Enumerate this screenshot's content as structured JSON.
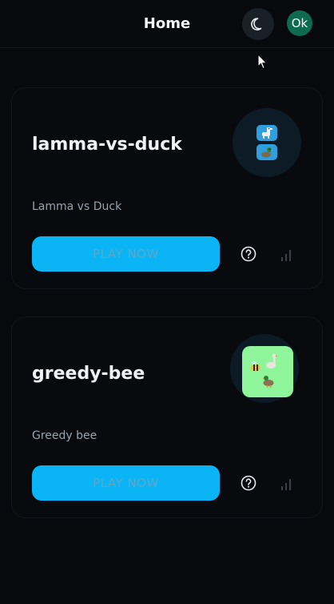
{
  "header": {
    "title": "Home",
    "theme_icon": "moon-icon",
    "avatar_initials": "Ok"
  },
  "cards": [
    {
      "title": "lamma-vs-duck",
      "description": "Lamma vs Duck",
      "play_label": "PLAY NOW",
      "icons": [
        "llama-icon",
        "duck-icon"
      ]
    },
    {
      "title": "greedy-bee",
      "description": "Greedy bee",
      "play_label": "PLAY NOW",
      "icons": [
        "bee-icon",
        "goose-icon",
        "duck-icon"
      ]
    }
  ],
  "colors": {
    "background": "#07090d",
    "accent": "#0ab4f5",
    "avatar": "#0f6b4f",
    "thumb_green": "#8ef59a"
  }
}
